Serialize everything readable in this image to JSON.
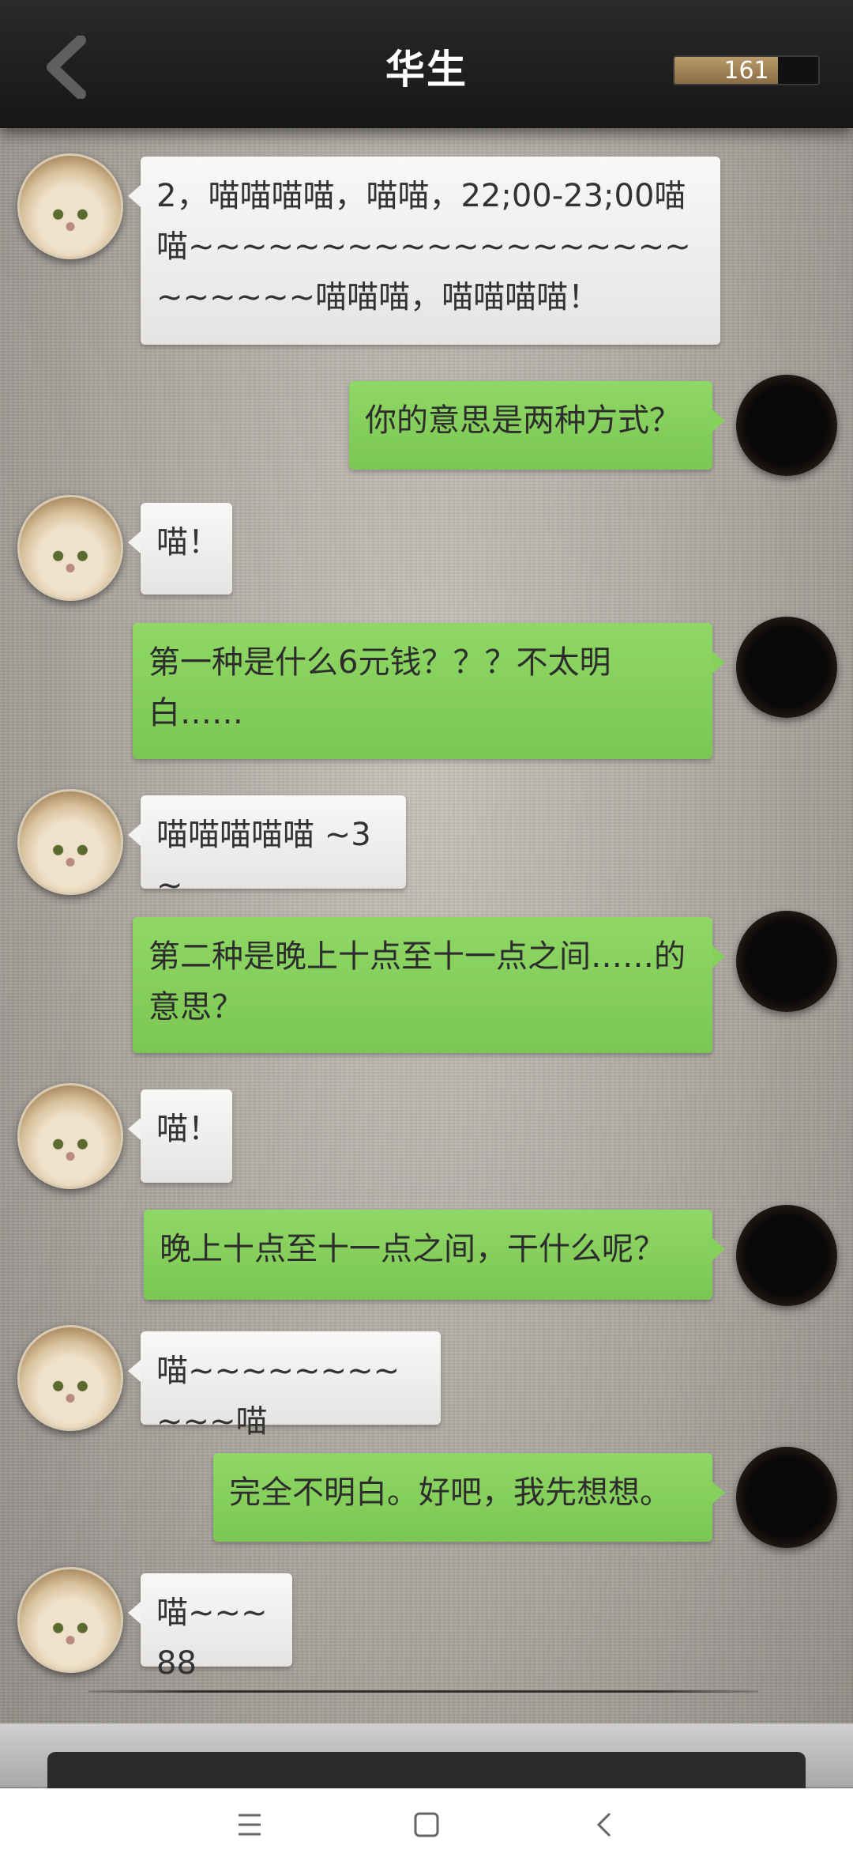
{
  "header": {
    "title": "华生",
    "counter": "161",
    "counter_fill_fraction": 0.72
  },
  "messages": [
    {
      "side": "in",
      "text": "2，喵喵喵喵，喵喵，22;00-23;00喵喵~~~~~~~~~~~~~~~~~~~~~~~~~喵喵喵，喵喵喵喵！"
    },
    {
      "side": "out",
      "text": "你的意思是两种方式？"
    },
    {
      "side": "in",
      "text": "喵！"
    },
    {
      "side": "out",
      "text": "第一种是什么6元钱？？？不太明白……"
    },
    {
      "side": "in",
      "text": "喵喵喵喵喵 ~3~"
    },
    {
      "side": "out",
      "text": "第二种是晚上十点至十一点之间……的意思？"
    },
    {
      "side": "in",
      "text": "喵！"
    },
    {
      "side": "out",
      "text": "晚上十点至十一点之间，干什么呢？"
    },
    {
      "side": "in",
      "text": "喵~~~~~~~~~~~喵"
    },
    {
      "side": "out",
      "text": "完全不明白。好吧，我先想想。"
    },
    {
      "side": "in",
      "text": "喵~~~88"
    }
  ],
  "icons": {
    "back": "chevron-left-icon",
    "nav_menu": "menu-icon",
    "nav_home": "square-icon",
    "nav_back": "back-icon"
  },
  "colors": {
    "header_bg": "#1c1c1c",
    "incoming_bubble": "#f1f1ef",
    "outgoing_bubble": "#84cc5a",
    "meter_fill": "#a88a5c"
  }
}
